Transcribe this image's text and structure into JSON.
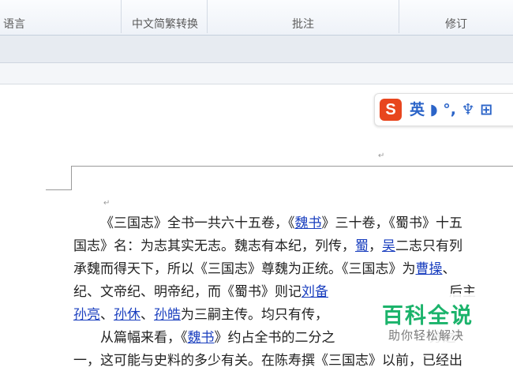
{
  "ribbon": {
    "groups": [
      {
        "label": "语言"
      },
      {
        "label": "中文简繁转换"
      },
      {
        "label": "批注"
      },
      {
        "label": "修订"
      }
    ]
  },
  "ime": {
    "logo": "S",
    "text": "英 ◗ °, ♆ ⊞"
  },
  "document": {
    "lines": [
      [
        {
          "t": "《三国志》全书一共六十五卷，《"
        },
        {
          "t": "魏书",
          "link": true
        },
        {
          "t": "》三十卷，《蜀书》十五"
        }
      ],
      [
        {
          "t": "国志》名：为志其实无志。魏志有本纪，列传，"
        },
        {
          "t": "蜀",
          "link": true
        },
        {
          "t": "，"
        },
        {
          "t": "吴",
          "link": true
        },
        {
          "t": "二志只有列"
        }
      ],
      [
        {
          "t": "承魏而得天下，所以《三国志》尊魏为正统。《三国志》为"
        },
        {
          "t": "曹操",
          "link": true
        },
        {
          "t": "、"
        }
      ],
      [
        {
          "t": "纪、文帝纪、明帝纪，而《蜀书》则记"
        },
        {
          "t": "刘备",
          "link": true
        },
        {
          "t": "　　　　　　　　　后主"
        }
      ],
      [
        {
          "t": "孙亮",
          "link": true
        },
        {
          "t": "、"
        },
        {
          "t": "孙休",
          "link": true
        },
        {
          "t": "、"
        },
        {
          "t": "孙皓",
          "link": true
        },
        {
          "t": "为三嗣主传。均只有传，"
        }
      ],
      [
        {
          "t": "　　从篇幅来看，《"
        },
        {
          "t": "魏书",
          "link": true
        },
        {
          "t": "》约占全书的二分之　　　　　　　分之"
        }
      ],
      [
        {
          "t": "一，这可能与史料的多少有关。在陈寿撰《三国志》以前，已经出"
        }
      ]
    ]
  },
  "watermark": {
    "title": "百科全说",
    "subtitle": "助你轻松解决"
  }
}
